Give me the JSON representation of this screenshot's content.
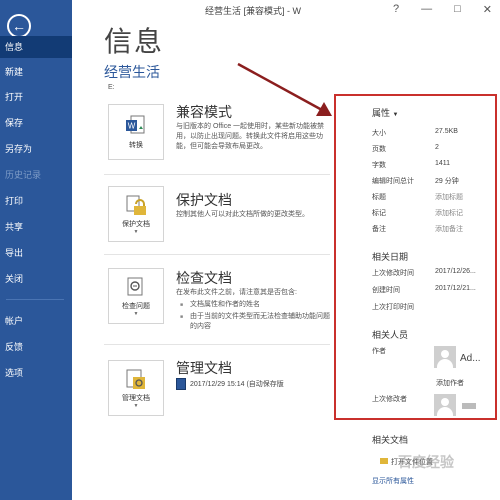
{
  "window": {
    "title": "经营生活 [兼容模式] - W"
  },
  "sidebar": {
    "items": [
      {
        "label": "信息"
      },
      {
        "label": "新建"
      },
      {
        "label": "打开"
      },
      {
        "label": "保存"
      },
      {
        "label": "另存为"
      },
      {
        "label": "历史记录"
      },
      {
        "label": "打印"
      },
      {
        "label": "共享"
      },
      {
        "label": "导出"
      },
      {
        "label": "关闭"
      },
      {
        "label": "帐户"
      },
      {
        "label": "反馈"
      },
      {
        "label": "选项"
      }
    ]
  },
  "main": {
    "heading": "信息",
    "doc_name": "经营生活",
    "doc_path": "E:",
    "compat": {
      "tile_label": "转换",
      "title": "兼容模式",
      "desc": "与旧版本的 Office 一起使用时，某些新功能被禁用，以防止出现问题。转换此文件将启用这些功能，但可能会导致布局更改。"
    },
    "protect": {
      "tile_label": "保护文档",
      "title": "保护文档",
      "desc": "控制其他人可以对此文档所做的更改类型。"
    },
    "inspect": {
      "tile_label": "检查问题",
      "title": "检查文档",
      "desc": "在发布此文件之前，请注意其是否包含:",
      "bullets": [
        "文档属性和作者的姓名",
        "由于当前的文件类型而无法检查辅助功能问题的内容"
      ]
    },
    "manage": {
      "tile_label": "管理文档",
      "title": "管理文档",
      "version": "2017/12/29 15:14 (自动保存版"
    }
  },
  "properties": {
    "heading": "属性",
    "rows": [
      {
        "label": "大小",
        "value": "27.5KB"
      },
      {
        "label": "页数",
        "value": "2"
      },
      {
        "label": "字数",
        "value": "1411"
      },
      {
        "label": "编辑时间总计",
        "value": "29 分钟"
      },
      {
        "label": "标题",
        "value": "添加标题"
      },
      {
        "label": "标记",
        "value": "添加标记"
      },
      {
        "label": "备注",
        "value": "添加备注"
      }
    ],
    "dates_heading": "相关日期",
    "dates": [
      {
        "label": "上次修改时间",
        "value": "2017/12/26..."
      },
      {
        "label": "创建时间",
        "value": "2017/12/21..."
      },
      {
        "label": "上次打印时间",
        "value": ""
      }
    ],
    "people_heading": "相关人员",
    "author_label": "作者",
    "author_name": "Ad...",
    "add_author": "添加作者",
    "last_modified_by": "上次修改者",
    "related_docs_heading": "相关文档",
    "open_location": "打开文件位置",
    "show_all": "显示所有属性"
  },
  "watermark": "百度经验",
  "colors": {
    "sidebar": "#2b579a",
    "highlight_border": "#c9302c",
    "arrow": "#8b1e1e"
  }
}
